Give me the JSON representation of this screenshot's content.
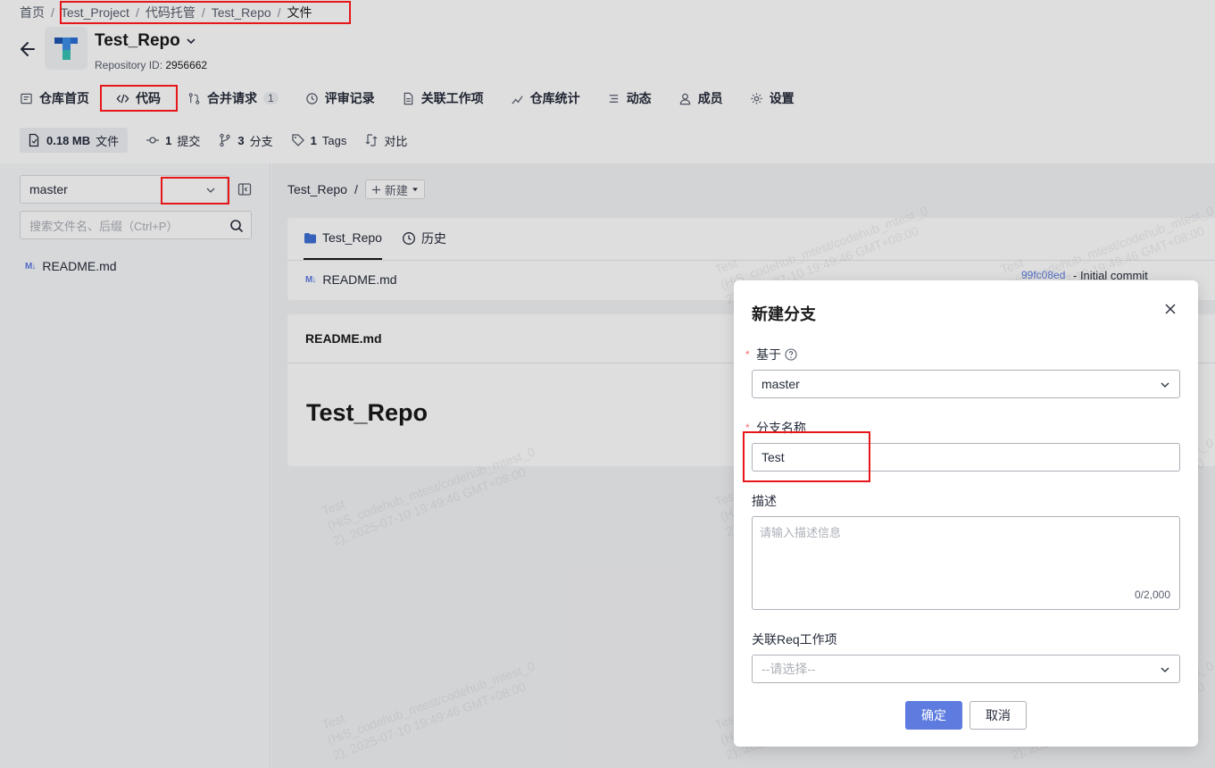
{
  "breadcrumb": {
    "items": [
      "首页",
      "Test_Project",
      "代码托管",
      "Test_Repo",
      "文件"
    ],
    "separator": "/"
  },
  "repo": {
    "title": "Test_Repo",
    "id_label": "Repository ID:",
    "id_value": "2956662"
  },
  "tabs": [
    {
      "label": "仓库首页",
      "icon": "home-icon"
    },
    {
      "label": "代码",
      "icon": "code-icon"
    },
    {
      "label": "合并请求",
      "icon": "merge-request-icon",
      "count": "1"
    },
    {
      "label": "评审记录",
      "icon": "review-icon"
    },
    {
      "label": "关联工作项",
      "icon": "workitem-icon"
    },
    {
      "label": "仓库统计",
      "icon": "chart-icon"
    },
    {
      "label": "动态",
      "icon": "list-icon"
    },
    {
      "label": "成员",
      "icon": "user-icon"
    },
    {
      "label": "设置",
      "icon": "gear-icon"
    }
  ],
  "stats": {
    "size": {
      "value": "0.18 MB",
      "label": "文件"
    },
    "commits": {
      "value": "1",
      "label": "提交"
    },
    "branches": {
      "value": "3",
      "label": "分支"
    },
    "tags": {
      "value": "1",
      "label": "Tags"
    },
    "compare": {
      "label": "对比"
    }
  },
  "sidebar": {
    "branch": "master",
    "search_placeholder": "搜索文件名、后缀（Ctrl+P）",
    "files": [
      {
        "badge": "M↓",
        "name": "README.md"
      }
    ]
  },
  "main": {
    "path": "Test_Repo",
    "path_sep": "/",
    "new_label": "新建",
    "card_tabs": [
      "Test_Repo",
      "历史"
    ],
    "file_row": {
      "name": "README.md",
      "commit": "99fc08ed",
      "commit_msg": "- Initial commit"
    },
    "readme": {
      "header": "README.md",
      "title": "Test_Repo"
    }
  },
  "modal": {
    "title": "新建分支",
    "required_mark": "*",
    "base_label": "基于",
    "base_value": "master",
    "name_label": "分支名称",
    "name_value": "Test",
    "desc_label": "描述",
    "desc_placeholder": "请输入描述信息",
    "desc_counter": "0/2,000",
    "req_label": "关联Req工作项",
    "req_placeholder": "--请选择--",
    "ok_label": "确定",
    "cancel_label": "取消"
  },
  "watermark": "Test\n(HiS_codehub_mtest/codehub_mtest_0\n2), 2025-07-10 19:49:46 GMT+08:00"
}
